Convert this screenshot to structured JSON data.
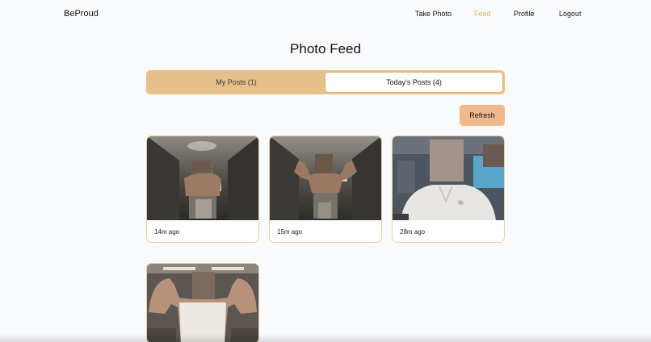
{
  "nav": {
    "brand": "BeProud",
    "links": [
      {
        "label": "Take Photo"
      },
      {
        "label": "Feed"
      },
      {
        "label": "Profile"
      },
      {
        "label": "Logout"
      }
    ],
    "active_color": "#e0b06d"
  },
  "main": {
    "title": "Photo Feed",
    "tabs": [
      {
        "label": "My Posts (1)"
      },
      {
        "label": "Today's Posts (4)"
      }
    ],
    "refresh_label": "Refresh"
  },
  "posts": [
    {
      "time": "14m ago",
      "image": "person-flexing-shirtless-hallway"
    },
    {
      "time": "15m ago",
      "image": "person-double-bicep-pose-hallway"
    },
    {
      "time": "28m ago",
      "image": "person-selfie-white-shirt"
    },
    {
      "time": "",
      "image": "person-flexing-white-tank"
    }
  ],
  "colors": {
    "accent": "#e6c08b",
    "button": "#f2b98c",
    "background": "#f9fafc"
  }
}
